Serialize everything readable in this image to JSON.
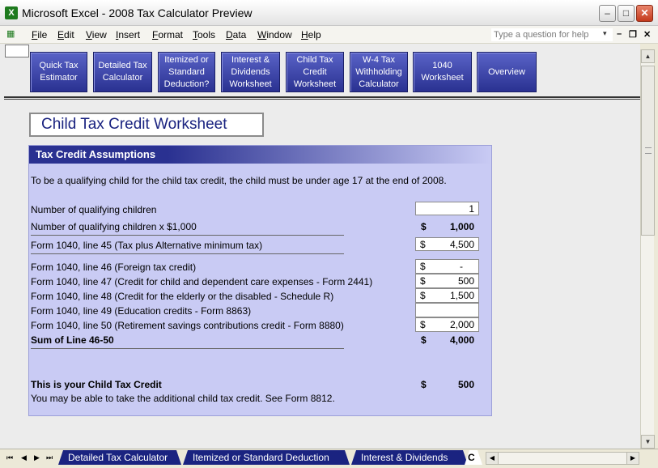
{
  "window": {
    "title": "Microsoft Excel - 2008 Tax Calculator Preview",
    "app_icon": "X",
    "minimize": "–",
    "maximize": "□",
    "close": "✕"
  },
  "menu": {
    "items": [
      "File",
      "Edit",
      "View",
      "Insert",
      "Format",
      "Tools",
      "Data",
      "Window",
      "Help"
    ],
    "ask_placeholder": "Type a question for help",
    "ask_arrow": "▾",
    "doc_minimize": "–",
    "doc_restore": "❐",
    "doc_close": "✕"
  },
  "nav_buttons": [
    "Quick Tax Estimator",
    "Detailed Tax Calculator",
    "Itemized or Standard Deduction?",
    "Interest & Dividends Worksheet",
    "Child Tax Credit Worksheet",
    "W-4 Tax Withholding Calculator",
    "1040 Worksheet",
    "Overview"
  ],
  "sheet": {
    "title": "Child Tax Credit Worksheet",
    "section_header": "Tax Credit Assumptions",
    "intro": "To be a qualifying child for the child tax credit, the child must be under age 17 at the end of 2008.",
    "rows": {
      "qualifying_children_label": "Number of qualifying children",
      "qualifying_children_value": "1",
      "times_1000_label": "Number of qualifying children x $1,000",
      "times_1000_currency": "$",
      "times_1000_value": "1,000",
      "line45_label": "Form 1040, line 45 (Tax plus Alternative minimum tax)",
      "line45_currency": "$",
      "line45_value": "4,500",
      "line46_label": "Form 1040, line 46 (Foreign tax credit)",
      "line46_currency": "$",
      "line46_value": "-",
      "line47_label": "Form 1040, line 47 (Credit for child and dependent care expenses - Form 2441)",
      "line47_currency": "$",
      "line47_value": "500",
      "line48_label": "Form 1040, line 48 (Credit for the elderly or the disabled - Schedule R)",
      "line48_currency": "$",
      "line48_value": "1,500",
      "line49_label": "Form 1040, line 49 (Education credits - Form 8863)",
      "line50_label": "Form 1040, line 50 (Retirement savings contributions credit - Form 8880)",
      "line50_currency": "$",
      "line50_value": "2,000",
      "sum_label": "Sum of Line 46-50",
      "sum_currency": "$",
      "sum_value": "4,000",
      "credit_label": "This is your Child Tax Credit",
      "credit_currency": "$",
      "credit_value": "500",
      "note": "You may be able to take the additional child tax credit. See Form 8812."
    }
  },
  "tabs": {
    "nav": [
      "⏮",
      "◀",
      "▶",
      "⏭"
    ],
    "items": [
      "Detailed Tax Calculator",
      "Itemized or Standard Deduction",
      "Interest & Dividends",
      "C"
    ]
  },
  "scroll": {
    "up": "▲",
    "down": "▼",
    "left": "◀",
    "right": "▶"
  },
  "colors": {
    "nav_button": "#2a3191",
    "card_bg": "#c9cbf4",
    "title_text": "#1a2380"
  }
}
